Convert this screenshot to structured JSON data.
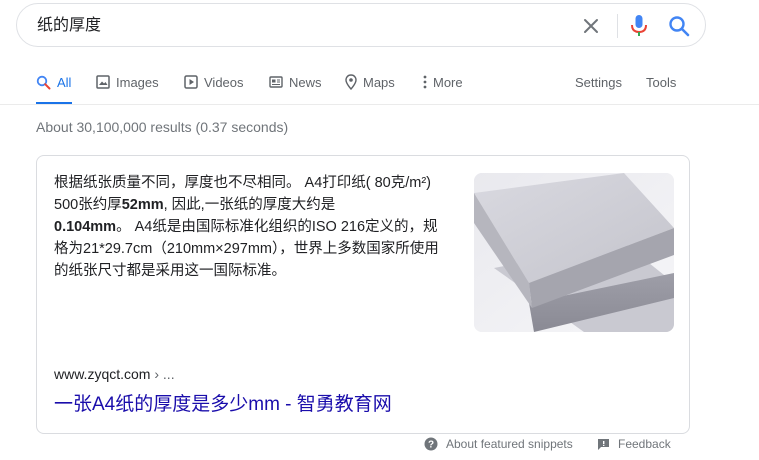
{
  "search": {
    "query": "纸的厚度"
  },
  "tabs": [
    {
      "label": "All",
      "icon": "search-icon",
      "active": true
    },
    {
      "label": "Images",
      "icon": "image-icon"
    },
    {
      "label": "Videos",
      "icon": "play-icon"
    },
    {
      "label": "News",
      "icon": "news-icon"
    },
    {
      "label": "Maps",
      "icon": "map-pin-icon"
    },
    {
      "label": "More",
      "icon": "more-vert-icon"
    }
  ],
  "tools": {
    "settings_label": "Settings",
    "tools_label": "Tools"
  },
  "result_stats": "About 30,100,000 results (0.37 seconds)",
  "featured_snippet": {
    "text_segments": [
      "根据纸张质量不同，厚度也不尽相同。 A4打印纸( 80克/m²) 500张约厚",
      "52mm",
      ", 因此,一张纸的厚度大约是",
      "0.104mm",
      "。 A4纸是由国际标准化组织的ISO 216定义的，规格为21*29.7cm（210mm×297mm），世界上多数国家所使用的纸张尺寸都是采用这一国际标准。"
    ],
    "cite_domain": "www.zyqct.com",
    "cite_suffix": "› ...",
    "title": "一张A4纸的厚度是多少mm - 智勇教育网"
  },
  "footer": {
    "about_label": "About featured snippets",
    "feedback_label": "Feedback"
  },
  "colors": {
    "accent": "#1a73e8",
    "link": "#1a0dab",
    "muted": "#70757a"
  }
}
